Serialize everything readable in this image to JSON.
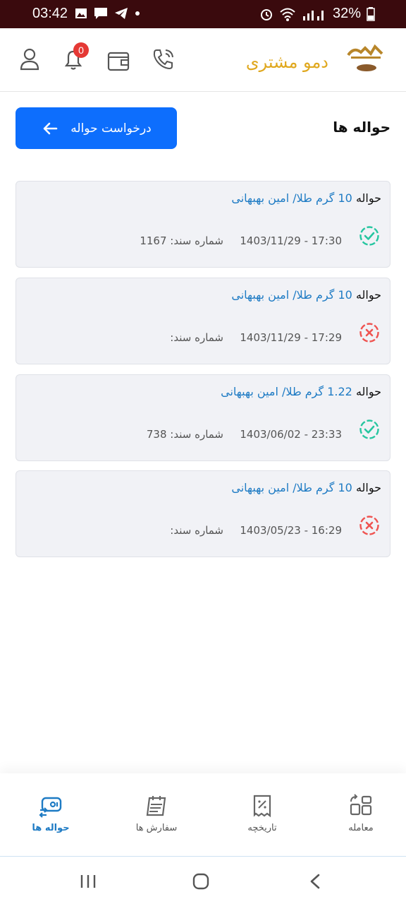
{
  "status_bar": {
    "time": "03:42",
    "battery": "32%"
  },
  "header": {
    "brand": "دمو مشتری",
    "notification_count": "0"
  },
  "page": {
    "title": "حواله ها",
    "request_button": "درخواست حواله"
  },
  "doc_label": "شماره سند:",
  "transfers": [
    {
      "word": "حواله",
      "amount": "10",
      "desc": "گرم طلا/ امین بهبهانی",
      "datetime": "1403/11/29 - 17:30",
      "doc_number": "1167",
      "status": "approved"
    },
    {
      "word": "حواله",
      "amount": "10",
      "desc": "گرم طلا/ امین بهبهانی",
      "datetime": "1403/11/29 - 17:29",
      "doc_number": "",
      "status": "rejected"
    },
    {
      "word": "حواله",
      "amount": "1.22",
      "desc": "گرم طلا/ امین بهبهانی",
      "datetime": "1403/06/02 - 23:33",
      "doc_number": "738",
      "status": "approved"
    },
    {
      "word": "حواله",
      "amount": "10",
      "desc": "گرم طلا/ امین بهبهانی",
      "datetime": "1403/05/23 - 16:29",
      "doc_number": "",
      "status": "rejected"
    }
  ],
  "bottom_nav": [
    {
      "label": "حواله ها",
      "icon": "transfer-icon",
      "active": true
    },
    {
      "label": "سفارش ها",
      "icon": "calendar-icon",
      "active": false
    },
    {
      "label": "تاریخچه",
      "icon": "receipt-icon",
      "active": false
    },
    {
      "label": "معامله",
      "icon": "trade-icon",
      "active": false
    }
  ],
  "colors": {
    "accent": "#0d6efd",
    "brand": "#e0a81e",
    "approved": "#26c6a0",
    "rejected": "#ef5350",
    "link": "#1e7bc4"
  }
}
